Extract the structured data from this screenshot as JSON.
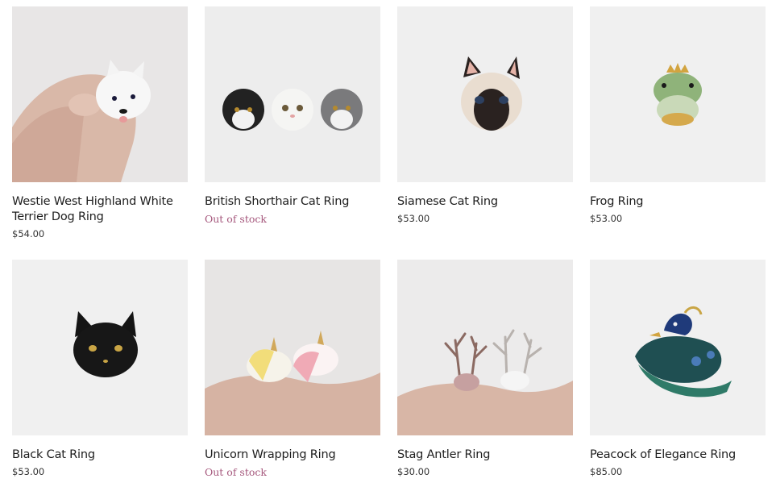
{
  "products": [
    {
      "title": "Westie West Highland White Terrier Dog Ring",
      "price": "$54.00",
      "stock": "",
      "image": "westie-ring-photo"
    },
    {
      "title": "British Shorthair Cat Ring",
      "price": "",
      "stock": "Out of stock",
      "image": "british-shorthair-ring-photo"
    },
    {
      "title": "Siamese Cat Ring",
      "price": "$53.00",
      "stock": "",
      "image": "siamese-ring-photo"
    },
    {
      "title": "Frog Ring",
      "price": "$53.00",
      "stock": "",
      "image": "frog-ring-photo"
    },
    {
      "title": "Black Cat Ring",
      "price": "$53.00",
      "stock": "",
      "image": "black-cat-ring-photo"
    },
    {
      "title": "Unicorn Wrapping Ring",
      "price": "",
      "stock": "Out of stock",
      "image": "unicorn-ring-photo"
    },
    {
      "title": "Stag Antler Ring",
      "price": "$30.00",
      "stock": "",
      "image": "stag-antler-ring-photo"
    },
    {
      "title": "Peacock of Elegance Ring",
      "price": "$85.00",
      "stock": "",
      "image": "peacock-ring-photo"
    }
  ],
  "colors": {
    "out_of_stock": "#a5577c",
    "title": "#1e1e1e",
    "price": "#333333"
  }
}
